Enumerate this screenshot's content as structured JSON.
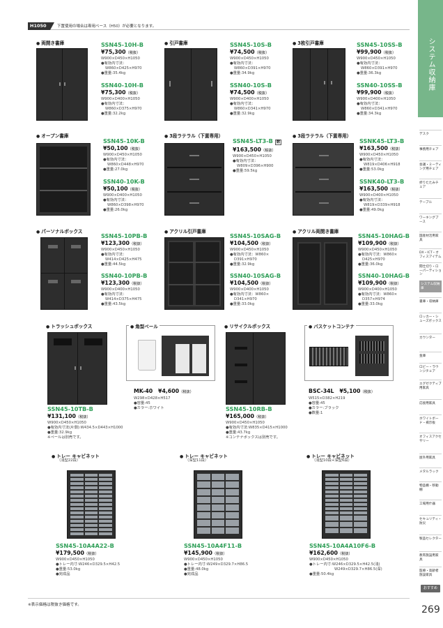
{
  "header": {
    "tag": "H1050",
    "note": "下置使用の場合は専用ベース（H50）が必要となります。"
  },
  "side_index": {
    "title": "システム収納庫",
    "items": [
      "デスク",
      "事務用チェア",
      "会議・ミーティング用チェア",
      "折りたたみチェア",
      "テーブル",
      "ワーキングブース",
      "国産材活用家具",
      "DX・ICT・オフィスアイテム",
      "間仕切り・ローパーティション",
      "システム収納庫",
      "書庫・収納庫",
      "ロッカー・シューズボックス",
      "カウンター",
      "金庫",
      "ロビー・ラウンジチェア",
      "エグゼクティブ用家具",
      "応接用家具",
      "ホワイトボード・掲示板",
      "オフィスアクセサリー",
      "屋外用家具",
      "メタルラック",
      "物品棚・移動棚",
      "工場用什器",
      "セキュリティ・防災",
      "製品セレクター",
      "教育施設用家具",
      "医療・高齢者施設家具"
    ],
    "active_index": 9,
    "foot_label": "おすすめ"
  },
  "page_number": "269",
  "footer_note": "※表示価格は税抜き価格です。",
  "sections": {
    "s1": "両開き書庫",
    "s2": "引戸書庫",
    "s3": "3枚引戸書庫",
    "s4": "オープン書庫",
    "s5": "3段ラテラル（下置専用）",
    "s6": "3段ラテラル（下置専用）",
    "s7": "パーソナルボックス",
    "s8": "アクリル引戸書庫",
    "s9": "アクリル両開き書庫",
    "s10": "トラッシュボックス",
    "s11": "角型ペール",
    "s12": "リサイクルボックス",
    "s13": "バスケットコンテナ",
    "s14": "トレー キャビネット",
    "s14_sub": "（浅型22段）",
    "s15": "トレー キャビネット",
    "s15_sub": "（深型11段）",
    "s16": "トレー キャビネット",
    "s16_sub": "（浅型10段+深型6段）"
  },
  "tax_label": "（税抜）",
  "products": {
    "p1": {
      "model": "SSN45-10H-B",
      "price": "¥75,300",
      "size": "W900×D450×H1050",
      "inner_label": "●有効内寸法：",
      "inner": "W860×D425×H970",
      "weight": "●重量:35.4kg"
    },
    "p2": {
      "model": "SSN40-10H-B",
      "price": "¥75,300",
      "size": "W900×D400×H1050",
      "inner_label": "●有効内寸法：",
      "inner": "W860×D375×H970",
      "weight": "●重量:32.2kg"
    },
    "p3": {
      "model": "SSN45-10S-B",
      "price": "¥74,500",
      "size": "W900×D450×H1050",
      "inner_label": "●有効内寸法：",
      "inner": "W860×D391×H970",
      "weight": "●重量:34.9kg"
    },
    "p4": {
      "model": "SSN40-10S-B",
      "price": "¥74,500",
      "size": "W900×D400×H1050",
      "inner_label": "●有効内寸法：",
      "inner": "W860×D341×H970",
      "weight": "●重量:32.9kg"
    },
    "p5": {
      "model": "SSN45-10SS-B",
      "price": "¥99,900",
      "size": "W900×D450×H1050",
      "inner_label": "●有効内寸法：",
      "inner": "W860×D391×H970",
      "weight": "●重量:36.3kg"
    },
    "p6": {
      "model": "SSN40-10SS-B",
      "price": "¥99,900",
      "size": "W900×D400×H1050",
      "inner_label": "●有効内寸法：",
      "inner": "W860×D341×H970",
      "weight": "●重量:34.3kg"
    },
    "p7": {
      "model": "SSN45-10K-B",
      "price": "¥50,100",
      "size": "W900×D450×H1050",
      "inner_label": "●有効内寸法：",
      "inner": "W860×D448×H970",
      "weight": "●重量:27.0kg"
    },
    "p8": {
      "model": "SSN40-10K-B",
      "price": "¥50,100",
      "size": "W900×D400×H1050",
      "inner_label": "●有効内寸法：",
      "inner": "W860×D398×H970",
      "weight": "●重量:26.0kg"
    },
    "p9": {
      "model": "SSN45-LT3-B",
      "badge": "数",
      "price": "¥163,500",
      "size": "W900×D450×H1050",
      "inner_label": "●有効内寸法：",
      "inner": "W809×D396×H900",
      "weight": "●重量:59.5kg"
    },
    "p10": {
      "model": "SSNK45-LT3-B",
      "price": "¥163,500",
      "size": "W900×D450×H1050",
      "inner_label": "●有効内寸法：",
      "inner": "W819×D406×H918",
      "weight": "●重量:53.0kg"
    },
    "p11": {
      "model": "SSNK40-LT3-B",
      "price": "¥163,500",
      "size": "W900×D400×H1050",
      "inner_label": "●有効内寸法：",
      "inner": "W819×D339×H918",
      "weight": "●重量:49.0kg"
    },
    "p12": {
      "model": "SSN45-10PB-B",
      "price": "¥123,300",
      "size": "W900×D450×H1050",
      "inner_label": "●有効内寸法：",
      "inner": "W414×D425×H475",
      "weight": "●重量:44.5kg"
    },
    "p13": {
      "model": "SSN40-10PB-B",
      "price": "¥123,300",
      "size": "W900×D400×H1050",
      "inner_label": "●有効内寸法：",
      "inner": "W414×D375×H475",
      "weight": "●重量:43.5kg"
    },
    "p14": {
      "model": "SSN45-10SAG-B",
      "price": "¥104,500",
      "size": "W900×D450×H1050",
      "inner_label": "●有効内寸法：W860×",
      "inner": "D391×H970",
      "weight": "●重量:32.9kg"
    },
    "p15": {
      "model": "SSN40-10SAG-B",
      "price": "¥104,500",
      "size": "W900×D400×H1050",
      "inner_label": "●有効内寸法：W860×",
      "inner": "D341×H970",
      "weight": "●重量:33.0kg"
    },
    "p16": {
      "model": "SSN45-10HAG-B",
      "price": "¥109,900",
      "size": "W900×D450×H1050",
      "inner_label": "●有効内寸法：W860×",
      "inner": "D425×H970",
      "weight": "●重量:36.0kg"
    },
    "p17": {
      "model": "SSN40-10HAG-B",
      "price": "¥109,900",
      "size": "W900×D400×H1050",
      "inner_label": "●有効内寸法：W860×",
      "inner": "D357×H974",
      "weight": "●重量:33.0kg"
    },
    "p18": {
      "model": "SSN45-10TB-B",
      "price": "¥131,100",
      "size": "W900×D450×H1050",
      "l1": "●有効内寸法(片側):W434.5×D443×H1000",
      "l2": "●重量:32.9kg",
      "l3": "※ペールは別売です。"
    },
    "p19": {
      "model": "MK-40",
      "price": "¥4,600",
      "size": "W298×D428×H517",
      "l1": "●容量:45",
      "l2": "●カラー:ホワイト"
    },
    "p20": {
      "model": "SSN45-10RB-B",
      "price": "¥165,000",
      "size": "W900×D450×H1050",
      "l1": "●有効内寸法:W835×D415×H1000",
      "l2": "●重量:43.7kg",
      "l3": "※コンテナボックスは別売です。"
    },
    "p21": {
      "model": "BSC-34L",
      "price": "¥5,100",
      "size": "W515×D382×H219",
      "l1": "●容量:45",
      "l2": "●カラー:ブラック",
      "l3": "●数量:1"
    },
    "p22": {
      "model": "SSN45-10A4A22-B",
      "price": "¥179,500",
      "size": "W900×D450×H1050",
      "l1": "●トレー内寸:W246×D329.5×H42.5",
      "l2": "●重量:53.0kg",
      "l3": "●完成品"
    },
    "p23": {
      "model": "SSN45-10A4F11-B",
      "price": "¥145,900",
      "size": "W900×D450×H1050",
      "l1": "●トレー内寸:W249×D329.7×H86.5",
      "l2": "●重量:48.0kg",
      "l3": "●完成品"
    },
    "p24": {
      "model": "SSN45-10A4A10F6-B",
      "price": "¥162,600",
      "size": "W900×D450×H1050",
      "l1": "●トレー内寸:W246×D329.5×H42.5(浅)",
      "l2": "W249×D329.7×H86.5(深)",
      "l3": "●重量:50.4kg"
    }
  }
}
